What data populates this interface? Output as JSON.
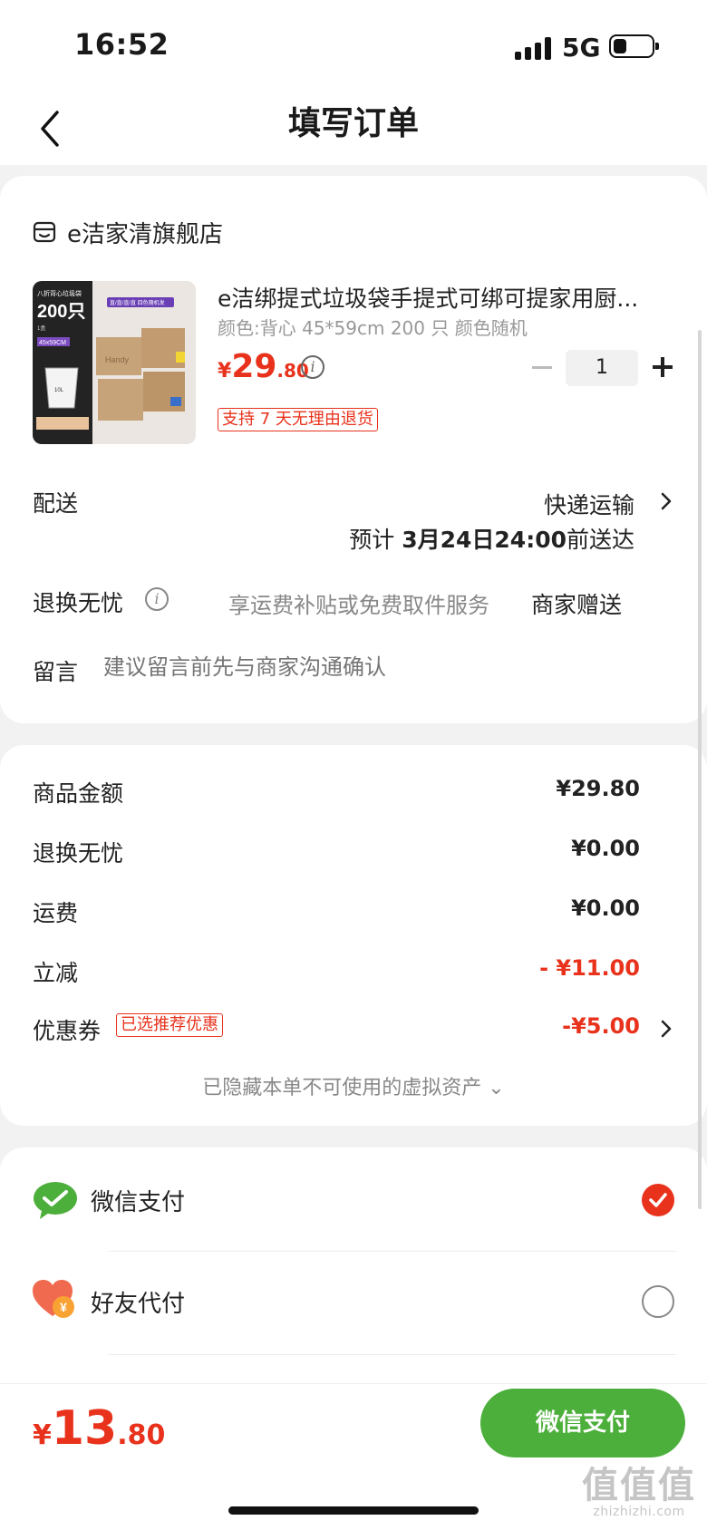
{
  "status_bar": {
    "time": "16:52",
    "network": "5G"
  },
  "nav": {
    "title": "填写订单"
  },
  "store": {
    "name": "e洁家清旗舰店"
  },
  "product": {
    "title": "e洁绑提式垃圾袋手提式可绑可提家用厨...",
    "spec": "颜色:背心 45*59cm 200 只 颜色随机",
    "price_currency": "¥",
    "price_int": "29",
    "price_dec": ".80",
    "quantity": "1",
    "return_badge": "支持 7 天无理由退货",
    "image_texts": {
      "caption": "八折背心垃圾袋",
      "count": "200只",
      "unit": "1盒",
      "size": "45x59CM",
      "capacity": "10L",
      "tag": "直/直/直/直 四色随机发",
      "box_label": "Handy"
    }
  },
  "delivery": {
    "label": "配送",
    "method": "快递运输",
    "eta_prefix": "预计",
    "eta_date": "3月24日24:00",
    "eta_suffix": "前送达"
  },
  "service": {
    "label": "退换无忧",
    "description": "享运费补贴或免费取件服务",
    "gift": "商家赠送"
  },
  "message": {
    "label": "留言",
    "placeholder": "建议留言前先与商家沟通确认"
  },
  "amounts": {
    "goods": {
      "label": "商品金额",
      "value": "¥29.80"
    },
    "service": {
      "label": "退换无忧",
      "value": "¥0.00"
    },
    "shipping": {
      "label": "运费",
      "value": "¥0.00"
    },
    "discount": {
      "label": "立减",
      "value": "- ¥11.00"
    },
    "coupon": {
      "label": "优惠券",
      "badge": "已选推荐优惠",
      "value": "-¥5.00"
    },
    "hidden_assets": "已隐藏本单不可使用的虚拟资产 ⌄"
  },
  "payment": {
    "methods": [
      {
        "label": "微信支付",
        "selected": true,
        "icon": "wechat-pay-icon"
      },
      {
        "label": "好友代付",
        "selected": false,
        "icon": "friend-pay-icon"
      }
    ]
  },
  "footer": {
    "total_currency": "¥",
    "total_int": "13",
    "total_dec": ".80",
    "pay_button": "微信支付"
  },
  "watermark": {
    "logo": "值值值",
    "url": "zhizhizhi.com"
  },
  "colors": {
    "accent_red": "#e8321c",
    "wechat_green": "#4caf3b",
    "background": "#f2f2f2"
  }
}
